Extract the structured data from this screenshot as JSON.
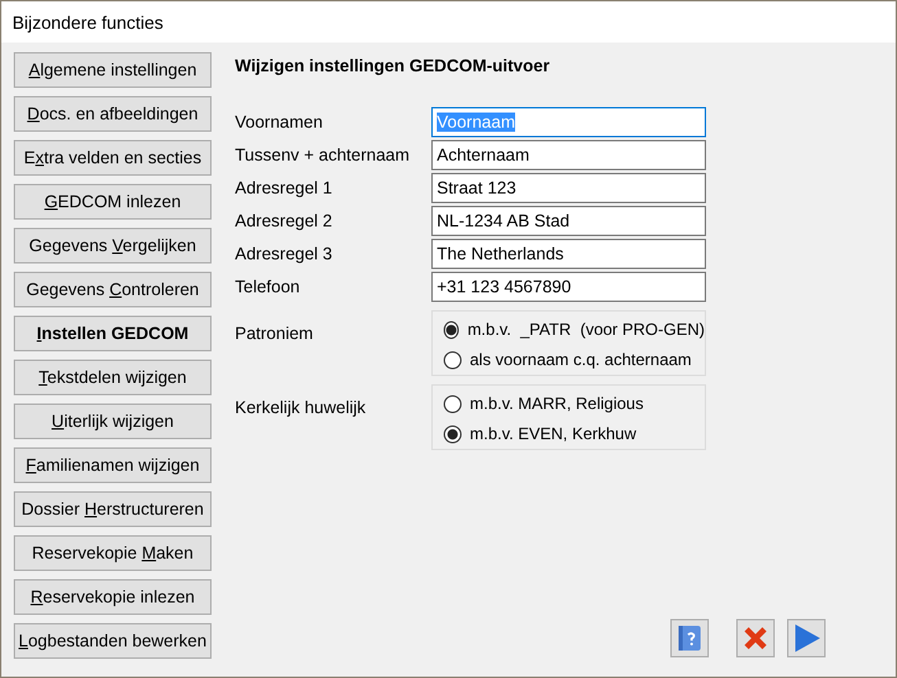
{
  "window": {
    "title": "Bijzondere functies"
  },
  "sidebar": {
    "items": [
      {
        "key": "A",
        "post": "lgemene instellingen",
        "selected": false
      },
      {
        "key": "D",
        "post": "ocs. en afbeeldingen",
        "selected": false
      },
      {
        "pre": "E",
        "key": "x",
        "post": "tra velden en secties",
        "selected": false
      },
      {
        "key": "G",
        "post": "EDCOM inlezen",
        "selected": false
      },
      {
        "pre": "Gegevens ",
        "key": "V",
        "post": "ergelijken",
        "selected": false
      },
      {
        "pre": "Gegevens ",
        "key": "C",
        "post": "ontroleren",
        "selected": false
      },
      {
        "key": "I",
        "post": "nstellen GEDCOM",
        "selected": true
      },
      {
        "key": "T",
        "post": "ekstdelen wijzigen",
        "selected": false
      },
      {
        "key": "U",
        "post": "iterlijk wijzigen",
        "selected": false
      },
      {
        "key": "F",
        "post": "amilienamen wijzigen",
        "selected": false
      },
      {
        "pre": "Dossier ",
        "key": "H",
        "post": "erstructureren",
        "selected": false
      },
      {
        "pre": "Reservekopie ",
        "key": "M",
        "post": "aken",
        "selected": false
      },
      {
        "key": "R",
        "post": "eservekopie inlezen",
        "selected": false
      },
      {
        "key": "L",
        "post": "ogbestanden bewerken",
        "selected": false
      }
    ]
  },
  "panel": {
    "heading": "Wijzigen instellingen GEDCOM-uitvoer",
    "fields": [
      {
        "label": "Voornamen",
        "value": "Voornaam",
        "highlighted": true
      },
      {
        "label": "Tussenv + achternaam",
        "value": "Achternaam",
        "highlighted": false
      },
      {
        "label": "Adresregel 1",
        "value": "Straat 123",
        "highlighted": false
      },
      {
        "label": "Adresregel 2",
        "value": "NL-1234 AB Stad",
        "highlighted": false
      },
      {
        "label": "Adresregel 3",
        "value": "The Netherlands",
        "highlighted": false
      },
      {
        "label": "Telefoon",
        "value": "+31 123 4567890",
        "highlighted": false
      }
    ],
    "radio_groups": [
      {
        "label": "Patroniem",
        "options": [
          {
            "label": "m.b.v.  _PATR  (voor PRO-GEN)",
            "selected": true
          },
          {
            "label": "als voornaam c.q. achternaam",
            "selected": false
          }
        ]
      },
      {
        "label": "Kerkelijk huwelijk",
        "options": [
          {
            "label": "m.b.v. MARR, Religious",
            "selected": false
          },
          {
            "label": "m.b.v. EVEN, Kerkhuw",
            "selected": true
          }
        ]
      }
    ]
  },
  "buttons": [
    {
      "kind": "help"
    },
    {
      "kind": "cancel"
    },
    {
      "kind": "next"
    }
  ]
}
